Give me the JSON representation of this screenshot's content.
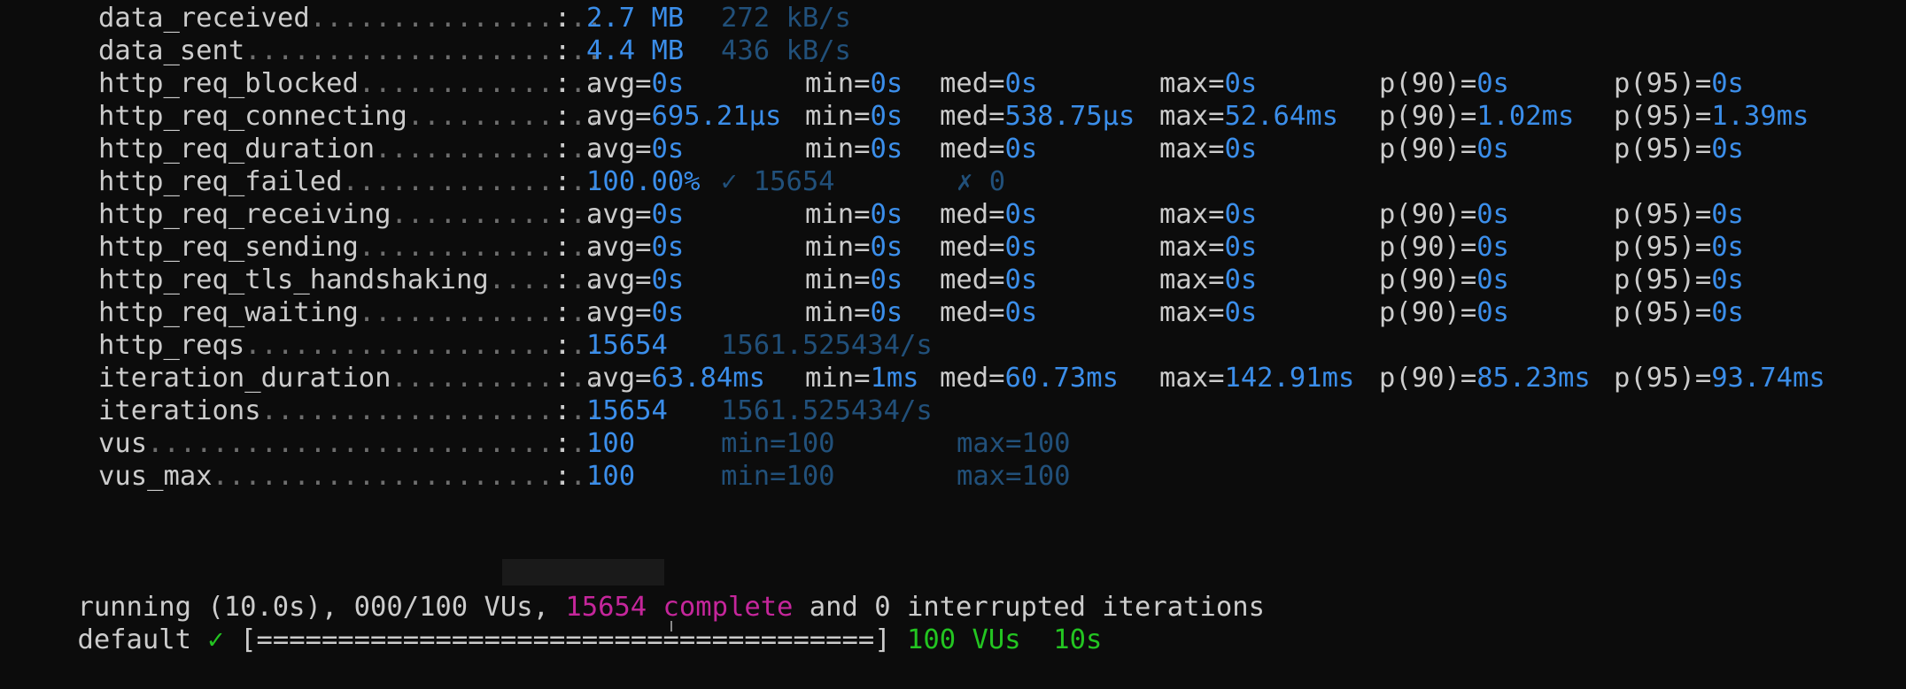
{
  "metrics": [
    {
      "name": "data_received",
      "dots": "..................",
      "cols": [
        {
          "t": "2.7 MB",
          "k": "val"
        },
        {
          "t": "272 kB/s",
          "k": "dim"
        }
      ]
    },
    {
      "name": "data_sent",
      "dots": "......................",
      "cols": [
        {
          "t": "4.4 MB",
          "k": "val"
        },
        {
          "t": "436 kB/s",
          "k": "dim"
        }
      ]
    },
    {
      "name": "http_req_blocked",
      "dots": "...............",
      "cols": [
        {
          "l": "avg=",
          "v": "0s"
        },
        {
          "l": "min=",
          "v": "0s"
        },
        {
          "l": "med=",
          "v": "0s"
        },
        {
          "l": "max=",
          "v": "0s"
        },
        {
          "l": "p(90)=",
          "v": "0s"
        },
        {
          "l": "p(95)=",
          "v": "0s"
        }
      ]
    },
    {
      "name": "http_req_connecting",
      "dots": "............",
      "cols": [
        {
          "l": "avg=",
          "v": "695.21µs"
        },
        {
          "l": "min=",
          "v": "0s"
        },
        {
          "l": "med=",
          "v": "538.75µs"
        },
        {
          "l": "max=",
          "v": "52.64ms"
        },
        {
          "l": "p(90)=",
          "v": "1.02ms"
        },
        {
          "l": "p(95)=",
          "v": "1.39ms"
        }
      ]
    },
    {
      "name": "http_req_duration",
      "dots": "..............",
      "cols": [
        {
          "l": "avg=",
          "v": "0s"
        },
        {
          "l": "min=",
          "v": "0s"
        },
        {
          "l": "med=",
          "v": "0s"
        },
        {
          "l": "max=",
          "v": "0s"
        },
        {
          "l": "p(90)=",
          "v": "0s"
        },
        {
          "l": "p(95)=",
          "v": "0s"
        }
      ]
    },
    {
      "name": "http_req_failed",
      "dots": "................",
      "cols": [
        {
          "t": "100.00%",
          "k": "val"
        },
        {
          "t": "✓ 15654",
          "k": "dim"
        },
        {
          "t": "✗ 0",
          "k": "dim"
        }
      ]
    },
    {
      "name": "http_req_receiving",
      "dots": ".............",
      "cols": [
        {
          "l": "avg=",
          "v": "0s"
        },
        {
          "l": "min=",
          "v": "0s"
        },
        {
          "l": "med=",
          "v": "0s"
        },
        {
          "l": "max=",
          "v": "0s"
        },
        {
          "l": "p(90)=",
          "v": "0s"
        },
        {
          "l": "p(95)=",
          "v": "0s"
        }
      ]
    },
    {
      "name": "http_req_sending",
      "dots": "...............",
      "cols": [
        {
          "l": "avg=",
          "v": "0s"
        },
        {
          "l": "min=",
          "v": "0s"
        },
        {
          "l": "med=",
          "v": "0s"
        },
        {
          "l": "max=",
          "v": "0s"
        },
        {
          "l": "p(90)=",
          "v": "0s"
        },
        {
          "l": "p(95)=",
          "v": "0s"
        }
      ]
    },
    {
      "name": "http_req_tls_handshaking",
      "dots": ".......",
      "cols": [
        {
          "l": "avg=",
          "v": "0s"
        },
        {
          "l": "min=",
          "v": "0s"
        },
        {
          "l": "med=",
          "v": "0s"
        },
        {
          "l": "max=",
          "v": "0s"
        },
        {
          "l": "p(90)=",
          "v": "0s"
        },
        {
          "l": "p(95)=",
          "v": "0s"
        }
      ]
    },
    {
      "name": "http_req_waiting",
      "dots": "...............",
      "cols": [
        {
          "l": "avg=",
          "v": "0s"
        },
        {
          "l": "min=",
          "v": "0s"
        },
        {
          "l": "med=",
          "v": "0s"
        },
        {
          "l": "max=",
          "v": "0s"
        },
        {
          "l": "p(90)=",
          "v": "0s"
        },
        {
          "l": "p(95)=",
          "v": "0s"
        }
      ]
    },
    {
      "name": "http_reqs",
      "dots": "......................",
      "cols": [
        {
          "t": "15654",
          "k": "val"
        },
        {
          "t": "1561.525434/s",
          "k": "dim"
        }
      ]
    },
    {
      "name": "iteration_duration",
      "dots": ".............",
      "cols": [
        {
          "l": "avg=",
          "v": "63.84ms"
        },
        {
          "l": "min=",
          "v": "1ms"
        },
        {
          "l": "med=",
          "v": "60.73ms"
        },
        {
          "l": "max=",
          "v": "142.91ms"
        },
        {
          "l": "p(90)=",
          "v": "85.23ms"
        },
        {
          "l": "p(95)=",
          "v": "93.74ms"
        }
      ]
    },
    {
      "name": "iterations",
      "dots": ".....................",
      "cols": [
        {
          "t": "15654",
          "k": "val"
        },
        {
          "t": "1561.525434/s",
          "k": "dim"
        }
      ]
    },
    {
      "name": "vus",
      "dots": "............................",
      "cols": [
        {
          "t": "100",
          "k": "val"
        },
        {
          "t": "min=100",
          "k": "dim"
        },
        {
          "t": "max=100",
          "k": "dim"
        }
      ]
    },
    {
      "name": "vus_max",
      "dots": "........................",
      "cols": [
        {
          "t": "100",
          "k": "val"
        },
        {
          "t": "min=100",
          "k": "dim"
        },
        {
          "t": "max=100",
          "k": "dim"
        }
      ]
    }
  ],
  "colon": ":",
  "running": {
    "prefix": "running (10.0s), 000/100 VUs, ",
    "complete": "15654 complete",
    "suffix": " and 0 interrupted iterations"
  },
  "progress": {
    "scenario": "default",
    "check": "✓",
    "bar": "[======================================]",
    "vus": "100 VUs",
    "duration": "10s"
  },
  "colors": {
    "background": "#0c0c0c",
    "text": "#cccccc",
    "value_blue": "#3b8eea",
    "dim_blue": "#21507a",
    "magenta": "#c5269b",
    "green": "#23c521"
  }
}
